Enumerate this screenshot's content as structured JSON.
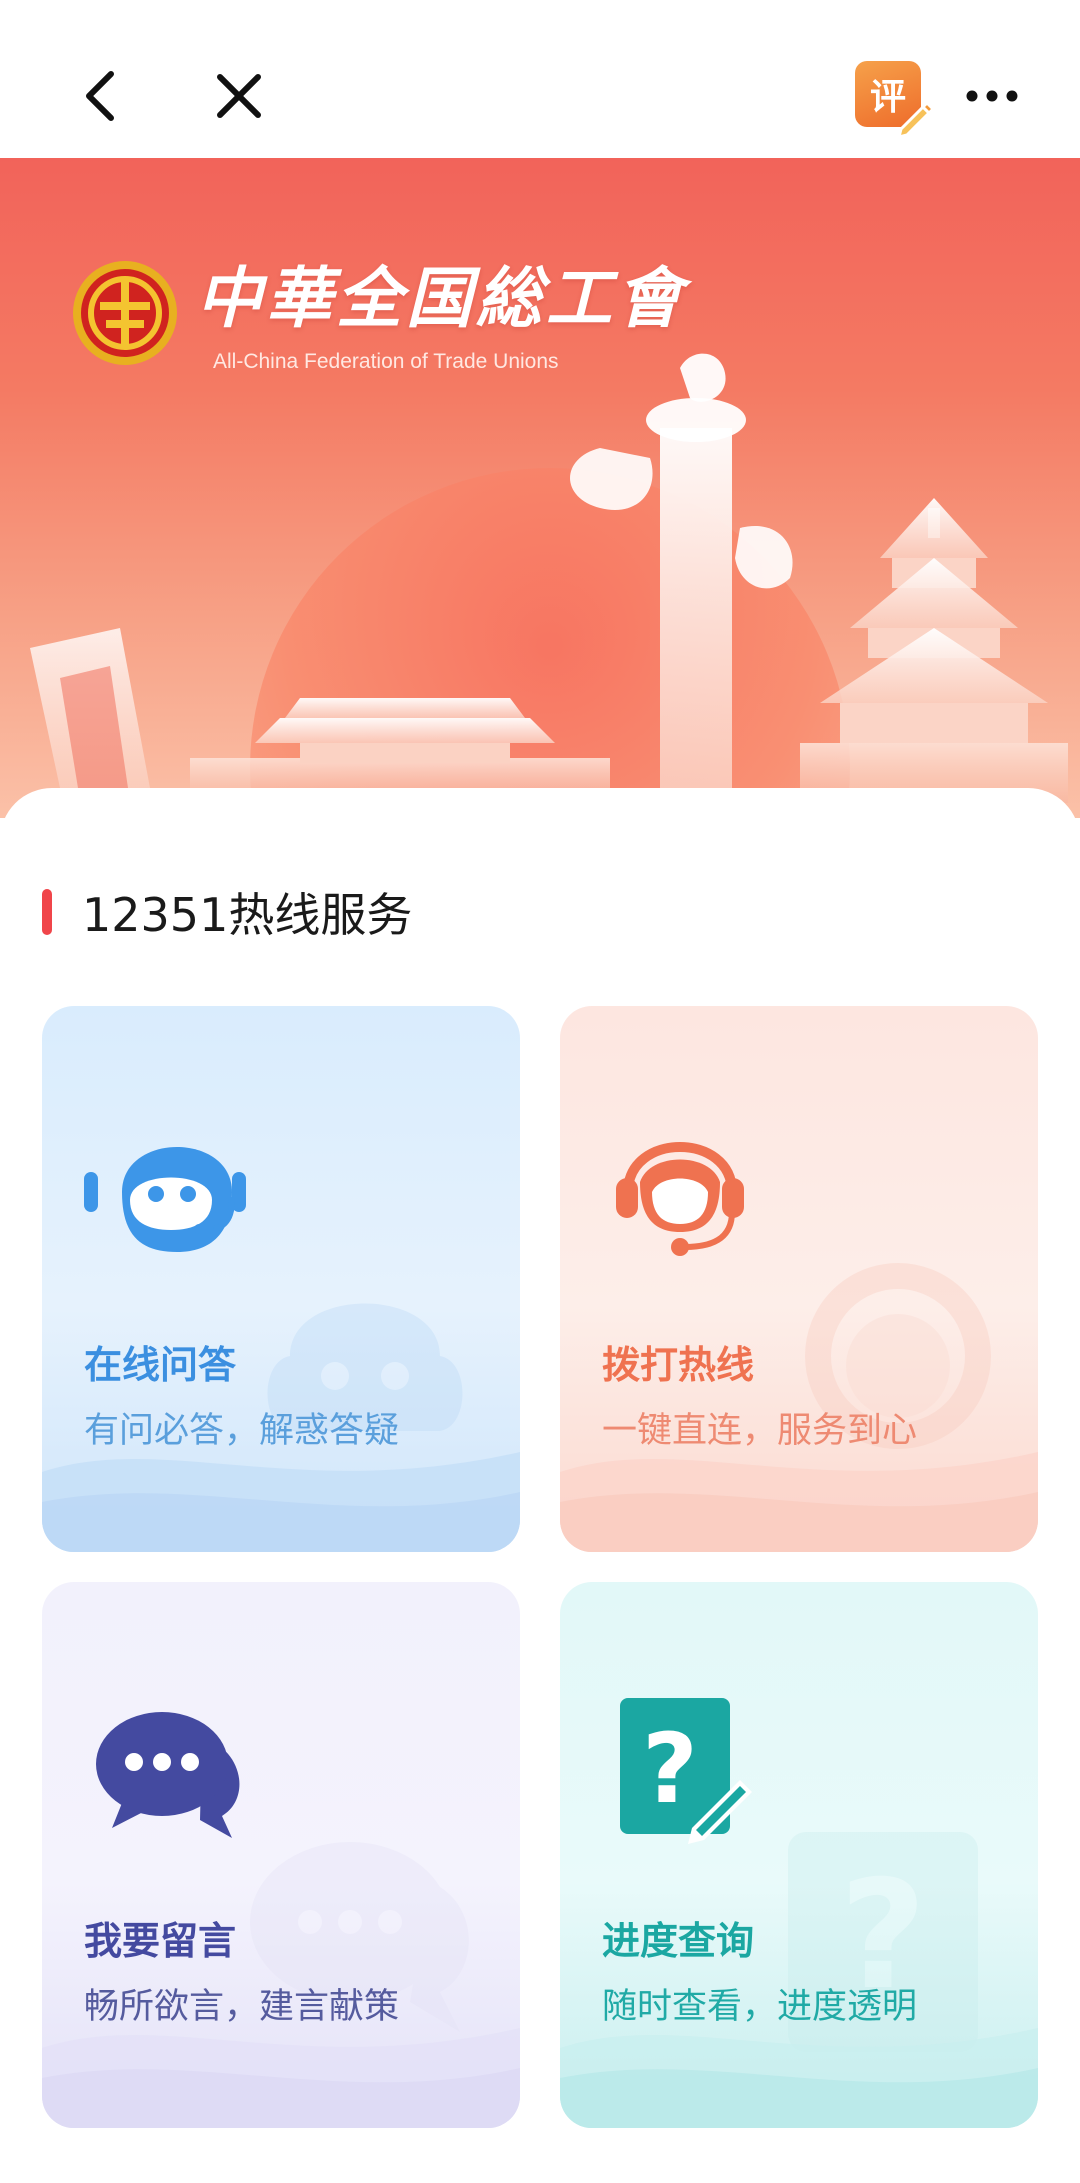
{
  "navbar": {
    "review_label": "评"
  },
  "hero": {
    "title": "中華全国総工會",
    "subtitle": "All-China Federation of Trade Unions"
  },
  "section": {
    "title": "12351热线服务"
  },
  "cards": [
    {
      "title": "在线问答",
      "desc": "有问必答，解惑答疑",
      "icon": "chat-robot-icon",
      "accent": "#3b8fe0"
    },
    {
      "title": "拨打热线",
      "desc": "一键直连，服务到心",
      "icon": "headset-agent-icon",
      "accent": "#ef7250"
    },
    {
      "title": "我要留言",
      "desc": "畅所欲言，建言献策",
      "icon": "speech-bubbles-icon",
      "accent": "#444aa0"
    },
    {
      "title": "进度查询",
      "desc": "随时查看，进度透明",
      "icon": "question-document-icon",
      "accent": "#1ba7a2"
    }
  ],
  "colors": {
    "hero_top": "#f2635a",
    "section_bar": "#f0454a"
  }
}
